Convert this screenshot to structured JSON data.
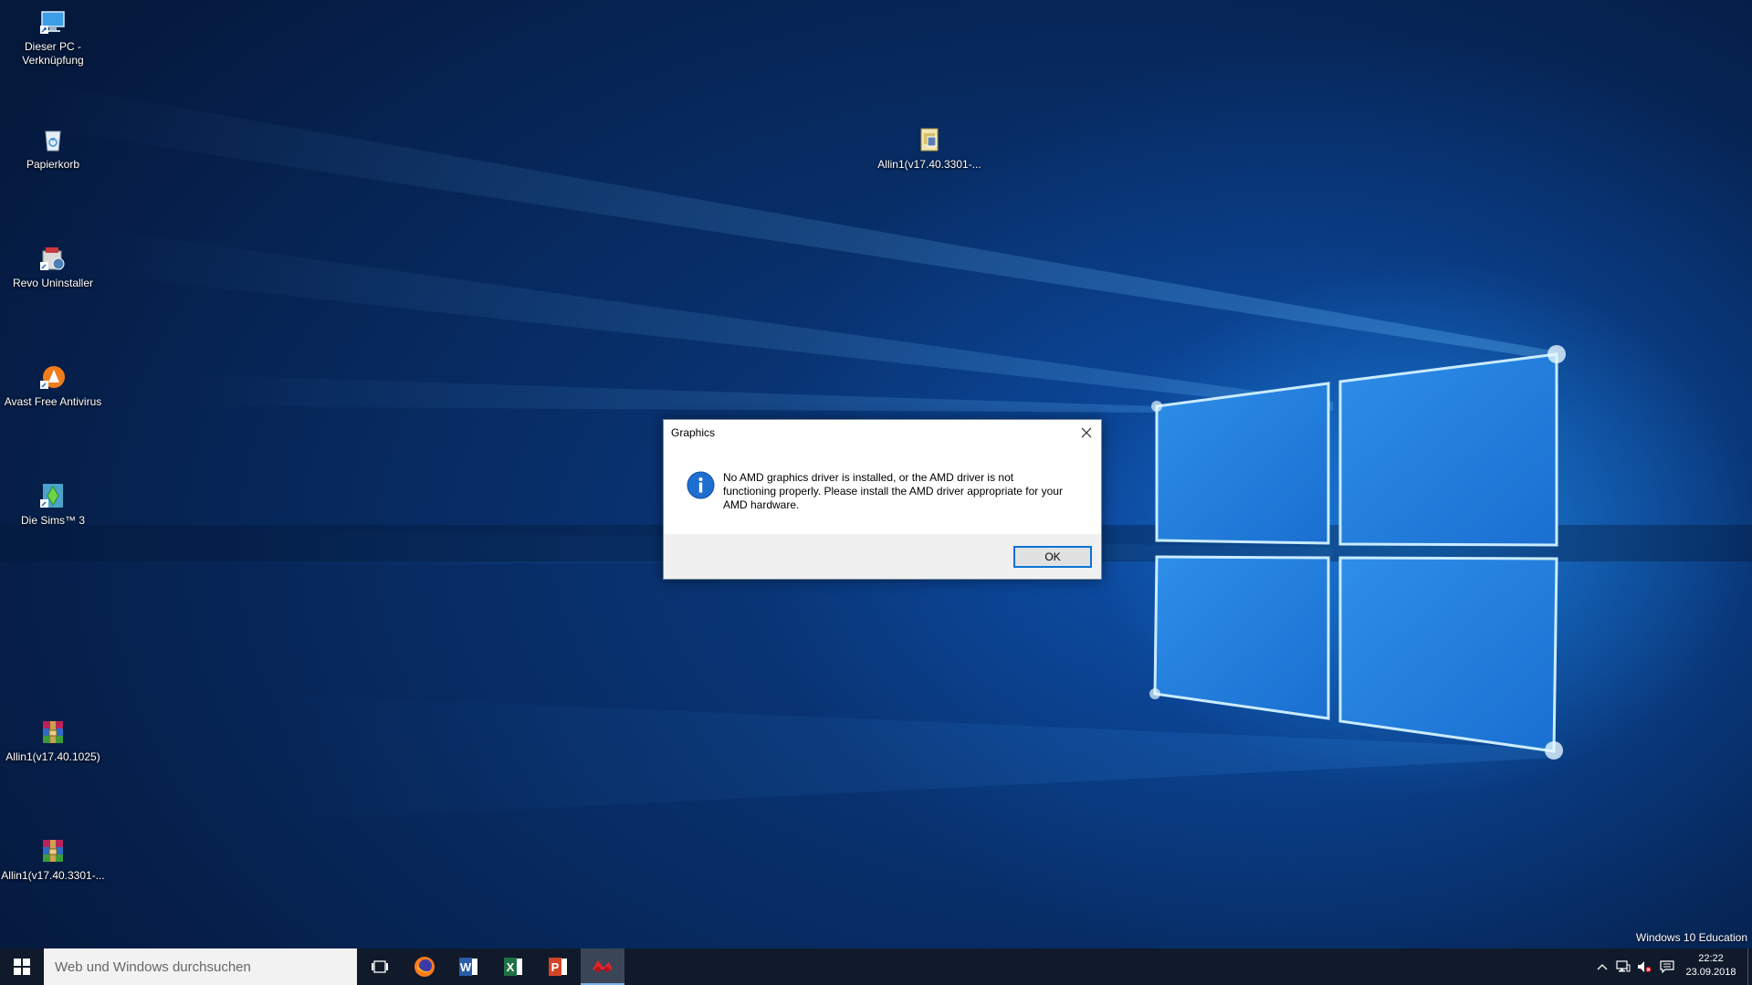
{
  "desktop": {
    "icons": [
      {
        "label": "Dieser PC -\nVerknüpfung",
        "icon": "computer-shortcut-icon"
      },
      {
        "label": "Papierkorb",
        "icon": "recycle-bin-icon"
      },
      {
        "label": "Revo Uninstaller",
        "icon": "revo-uninstaller-icon"
      },
      {
        "label": "Avast Free Antivirus",
        "icon": "avast-icon"
      },
      {
        "label": "Die Sims™ 3",
        "icon": "sims-icon"
      },
      {
        "label": "Allin1(v17.40.1025)",
        "icon": "winrar-archive-icon"
      },
      {
        "label": "Allin1(v17.40.3301-...",
        "icon": "winrar-archive-icon"
      },
      {
        "label": "Allin1(v17.40.3301-...",
        "icon": "installer-folder-icon"
      }
    ]
  },
  "dialog": {
    "title": "Graphics",
    "icon": "info-icon",
    "message": "No AMD graphics driver is installed, or the AMD driver is not\nfunctioning properly. Please install the AMD driver appropriate for your\nAMD hardware.",
    "ok_label": "OK"
  },
  "watermark": "Windows 10 Education",
  "taskbar": {
    "search_placeholder": "Web und Windows durchsuchen",
    "apps": [
      {
        "name": "task-view",
        "icon": "task-view-icon"
      },
      {
        "name": "firefox",
        "icon": "firefox-icon"
      },
      {
        "name": "word",
        "icon": "word-icon"
      },
      {
        "name": "excel",
        "icon": "excel-icon"
      },
      {
        "name": "powerpoint",
        "icon": "powerpoint-icon"
      },
      {
        "name": "amd-radeon",
        "icon": "amd-radeon-icon",
        "active": true
      }
    ],
    "tray": [
      "chevron-up-icon",
      "network-icon",
      "volume-muted-icon",
      "action-center-icon"
    ],
    "clock": {
      "time": "22:22",
      "date": "23.09.2018"
    }
  },
  "colors": {
    "accent": "#0a74d6",
    "taskbar": "#101a2a",
    "desktop": "#0b3f8a"
  }
}
